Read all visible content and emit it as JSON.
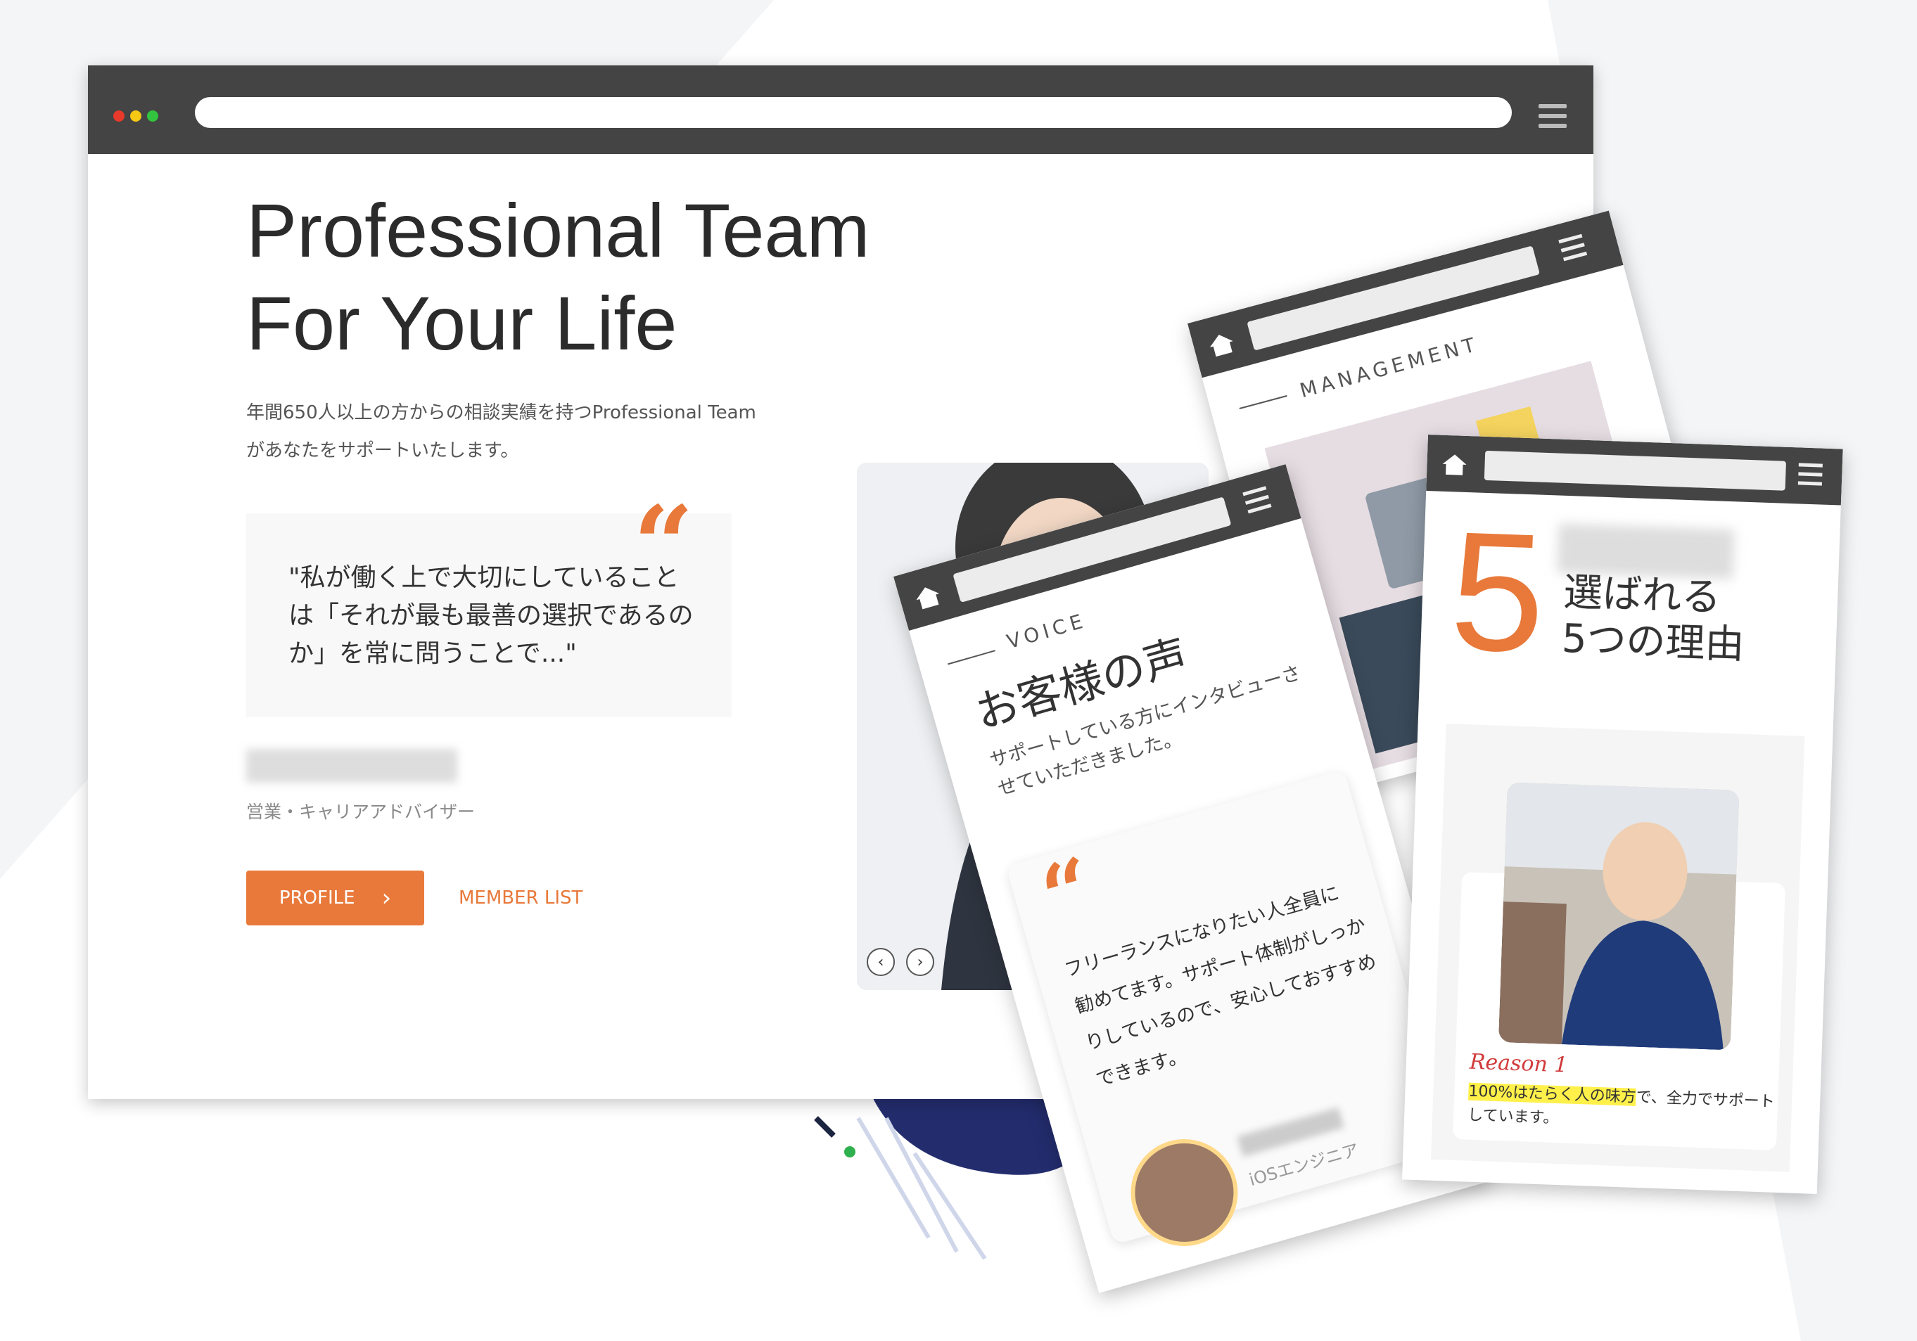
{
  "main": {
    "title_line1": "Professional Team",
    "title_line2": "For Your Life",
    "subtitle_line1": "年間650人以上の方からの相談実績を持つProfessional Team",
    "subtitle_line2": "があなたをサポートいたします。",
    "quote_mark": "“",
    "quote_text": "\"私が働く上で大切にしていることは「それが最も最善の選択であるのか」を常に問うことで...\"",
    "role": "営業・キャリアアドバイザー",
    "profile_button": "PROFILE",
    "member_list_link": "MEMBER LIST"
  },
  "management_phone": {
    "eyebrow": "MANAGEMENT"
  },
  "voice_phone": {
    "eyebrow": "VOICE",
    "heading": "お客様の声",
    "intro": "サポートしている方にインタビューさせていただきました。",
    "quote_mark": "“",
    "testimonial": "フリーランスになりたい人全員に勧めてます。サポート体制がしっかりしているので、安心しておすすめできます。",
    "role": "iOSエンジニア"
  },
  "reasons_phone": {
    "big_number": "5",
    "heading_line1": "選ばれる",
    "heading_line2": "5つの理由",
    "reason_label": "Reason 1",
    "reason_highlight": "100%はたらく人の味方",
    "reason_rest": "で、全力でサポートしています。"
  },
  "colors": {
    "accent": "#e8793a",
    "browser_bar": "#444444",
    "navy": "#1f2a6b",
    "highlight": "#fff04a"
  }
}
